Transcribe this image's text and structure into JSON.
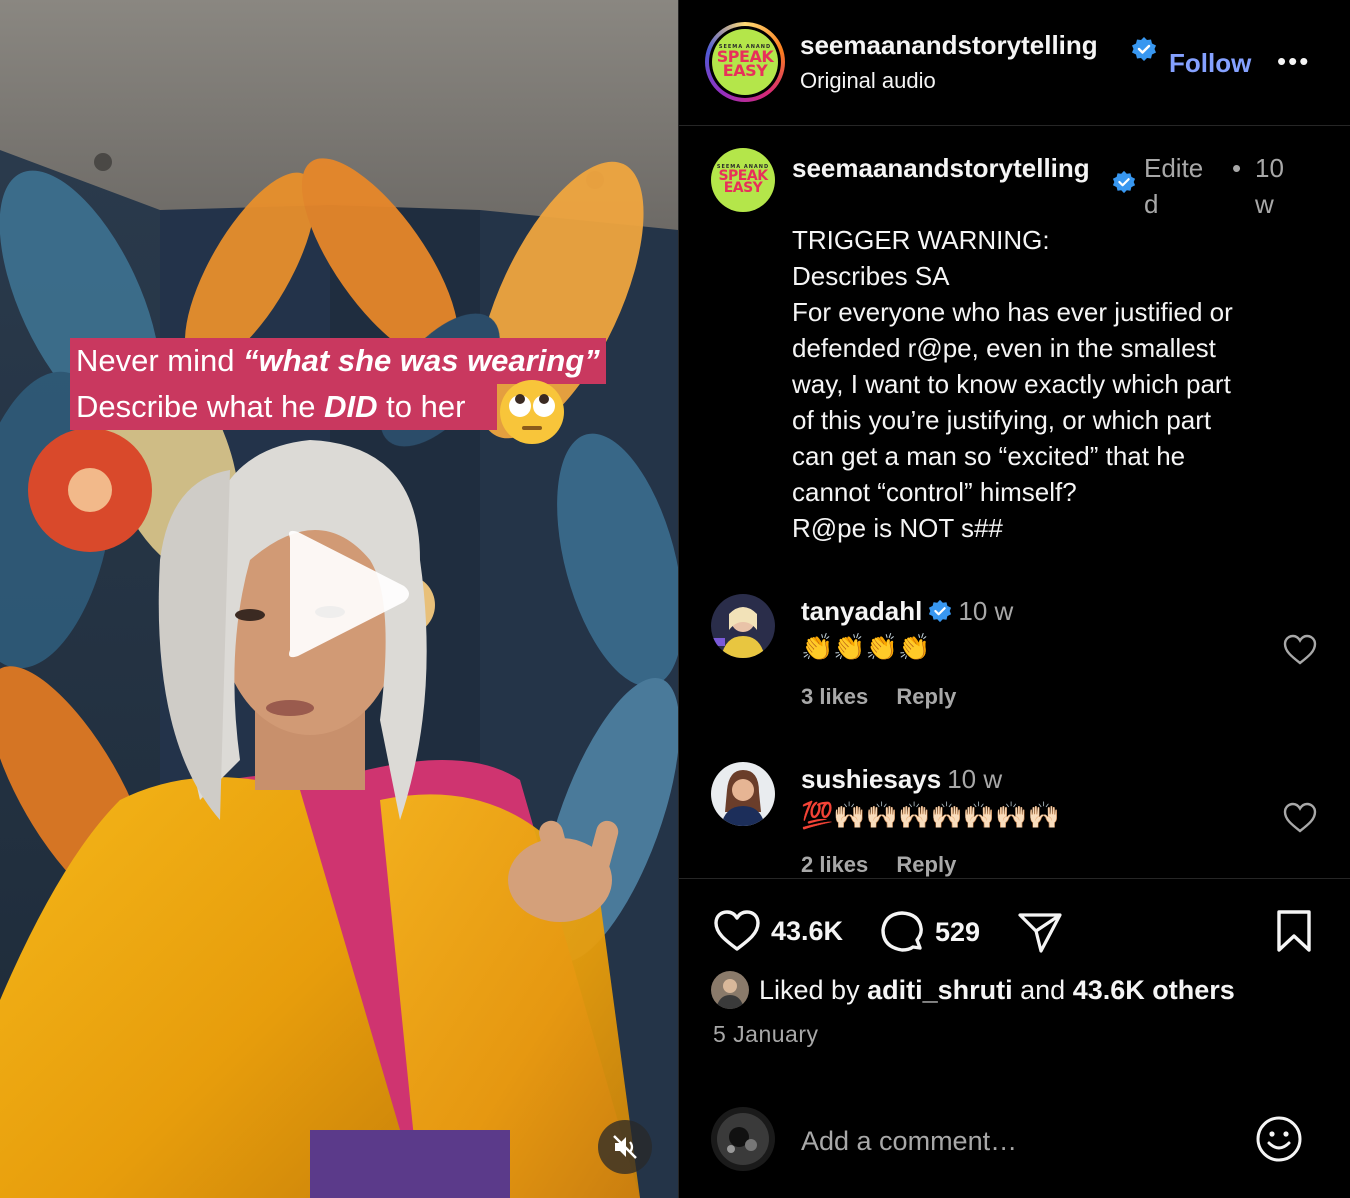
{
  "video": {
    "caption_line1_pre": "Never mind ",
    "caption_line1_em": "“what she was wearing”",
    "caption_line2_pre": "Describe what he ",
    "caption_line2_em": "DID",
    "caption_line2_post": " to her"
  },
  "header": {
    "username": "seemaanandstorytelling",
    "subtitle": "Original audio",
    "follow_label": "Follow",
    "more_label": "•••",
    "avatar_text_top": "SPEAK",
    "avatar_text_bottom": "EASY",
    "avatar_mini": "SEEMA ANAND"
  },
  "caption_post": {
    "username": "seemaanandstorytelling",
    "edited": "Edited",
    "dot": "•",
    "age": "10w",
    "lines": [
      "TRIGGER WARNING:",
      "Describes SA",
      "For everyone who has ever justified or",
      "defended r@pe, even in the smallest",
      "way, I want to know exactly which part",
      "of this you’re justifying, or which part",
      "can get a man so “excited” that he",
      "cannot “control” himself?",
      "R@pe is NOT s##"
    ]
  },
  "comments": [
    {
      "username": "tanyadahl",
      "time": "10 w",
      "text": "👏👏👏👏",
      "likes": "3 likes",
      "reply": "Reply"
    },
    {
      "username": "sushiesays",
      "time": "10 w",
      "text": "💯🙌🏻🙌🏻🙌🏻🙌🏻🙌🏻🙌🏻🙌🏻",
      "likes": "2 likes",
      "reply": "Reply"
    }
  ],
  "actions": {
    "likes_count": "43.6K",
    "comments_count": "529",
    "liked_by_prefix": "Liked by ",
    "liked_by_user": "aditi_shruti",
    "liked_by_mid": " and ",
    "liked_by_others": "43.6K others",
    "date": "5 January"
  },
  "add_comment": {
    "placeholder": "Add a comment…"
  },
  "colors": {
    "accent": "#85a1ff",
    "caption_bg": "#c9385f",
    "verified": "#3897f0",
    "avatar_green": "#b4e64a"
  }
}
